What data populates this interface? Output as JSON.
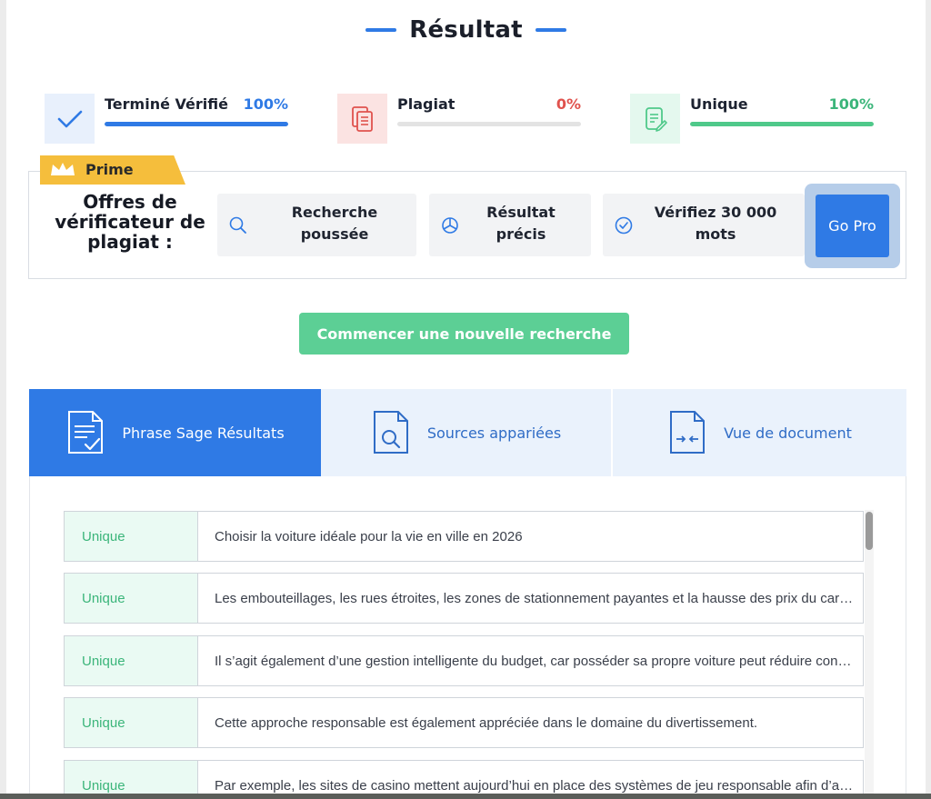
{
  "header": {
    "title": "Résultat"
  },
  "stats": [
    {
      "label": "Terminé Vérifié",
      "value": "100%",
      "percent": 100,
      "color": "#2f7ae5",
      "icon": "check-icon"
    },
    {
      "label": "Plagiat",
      "value": "0%",
      "percent": 0,
      "color": "#e0524d",
      "icon": "copy-document-icon"
    },
    {
      "label": "Unique",
      "value": "100%",
      "percent": 100,
      "color": "#4fc98a",
      "icon": "edit-document-icon"
    }
  ],
  "offers": {
    "badge": "Prime",
    "heading": "Offres de vérificateur de plagiat :",
    "items": [
      {
        "label": "Recherche poussée",
        "icon": "search-icon"
      },
      {
        "label": "Résultat précis",
        "icon": "pie-chart-icon"
      },
      {
        "label": "Vérifiez 30 000 mots",
        "icon": "check-circle-icon"
      }
    ],
    "cta": "Go Pro"
  },
  "new_search_button": "Commencer une nouvelle recherche",
  "tabs": [
    {
      "label": "Phrase Sage Résultats",
      "icon": "document-check-icon",
      "active": true
    },
    {
      "label": "Sources appariées",
      "icon": "document-search-icon",
      "active": false
    },
    {
      "label": "Vue de document",
      "icon": "document-compare-icon",
      "active": false
    }
  ],
  "results": [
    {
      "status": "Unique",
      "text": "Choisir la voiture idéale pour la vie en ville en 2026"
    },
    {
      "status": "Unique",
      "text": "Les embouteillages, les rues étroites, les zones de stationnement payantes et la hausse des prix du carbu…"
    },
    {
      "status": "Unique",
      "text": "Il s’agit également d’une gestion intelligente du budget, car posséder sa propre voiture peut réduire consi…"
    },
    {
      "status": "Unique",
      "text": "Cette approche responsable est également appréciée dans le domaine du divertissement."
    },
    {
      "status": "Unique",
      "text": "Par exemple, les sites de casino mettent aujourd’hui en place des systèmes de jeu responsable afin d’aid…"
    }
  ]
}
